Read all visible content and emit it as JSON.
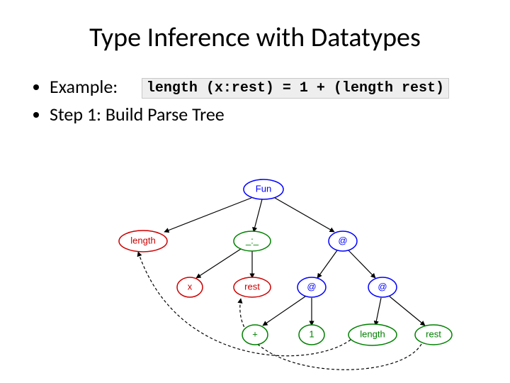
{
  "title": "Type Inference with Datatypes",
  "bullets": {
    "example_label": "Example:",
    "code": "length (x:rest) = 1 + (length rest)",
    "step1": "Step 1: Build Parse Tree"
  },
  "tree": {
    "root": {
      "label": "Fun",
      "color": "blue"
    },
    "length_def": {
      "label": "length",
      "color": "red"
    },
    "cons": {
      "label": "_:_",
      "color": "green"
    },
    "app_top": {
      "label": "@",
      "color": "blue"
    },
    "x": {
      "label": "x",
      "color": "red"
    },
    "rest": {
      "label": "rest",
      "color": "red"
    },
    "app_plus": {
      "label": "@",
      "color": "blue"
    },
    "app_len": {
      "label": "@",
      "color": "blue"
    },
    "plus": {
      "label": "+",
      "color": "green"
    },
    "one": {
      "label": "1",
      "color": "green"
    },
    "length_use": {
      "label": "length",
      "color": "green"
    },
    "rest_use": {
      "label": "rest",
      "color": "green"
    }
  }
}
